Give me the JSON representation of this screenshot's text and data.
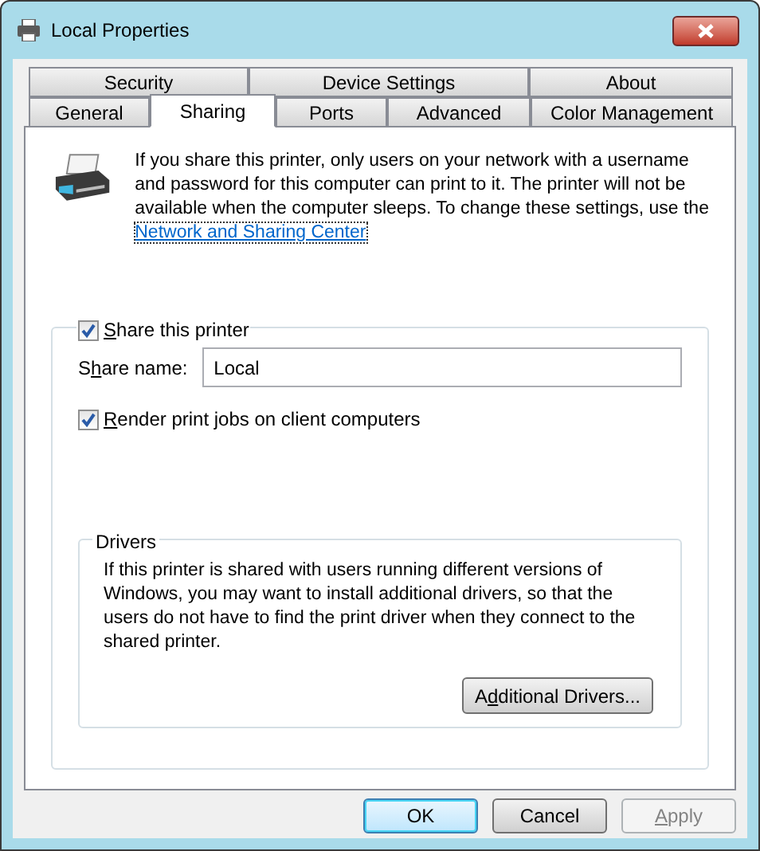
{
  "window": {
    "title": "Local Properties"
  },
  "tab_rows": [
    {
      "tabs": [
        {
          "label": "Security",
          "selected": false
        },
        {
          "label": "Device Settings",
          "selected": false
        },
        {
          "label": "About",
          "selected": false
        }
      ]
    },
    {
      "tabs": [
        {
          "label": "General",
          "selected": false
        },
        {
          "label": "Sharing",
          "selected": true
        },
        {
          "label": "Ports",
          "selected": false
        },
        {
          "label": "Advanced",
          "selected": false
        },
        {
          "label": "Color Management",
          "selected": false
        }
      ]
    }
  ],
  "intro": {
    "text": "If you share this printer, only users on your network with a username and password for this computer can print to it. The printer will not be available when the computer sleeps. To change these settings, use the",
    "link": "Network and Sharing Center"
  },
  "share_checkbox": {
    "key": "S",
    "after": "hare this printer",
    "checked": true
  },
  "share_name": {
    "before": "S",
    "key": "h",
    "after": "are name:",
    "value": "Local"
  },
  "render_checkbox": {
    "key": "R",
    "after": "ender print jobs on client computers",
    "checked": true
  },
  "drivers": {
    "title": "Drivers",
    "text": "If this printer is shared with users running different versions of Windows, you may want to install additional drivers, so that the users do not have to find the print driver when they connect to the shared printer.",
    "button": {
      "before": "A",
      "key": "d",
      "after": "ditional Drivers..."
    }
  },
  "buttons": [
    {
      "before": "OK",
      "default": true,
      "disabled": false
    },
    {
      "before": "Cancel",
      "default": false,
      "disabled": false
    },
    {
      "key": "A",
      "after": "pply",
      "disabled": true
    }
  ]
}
